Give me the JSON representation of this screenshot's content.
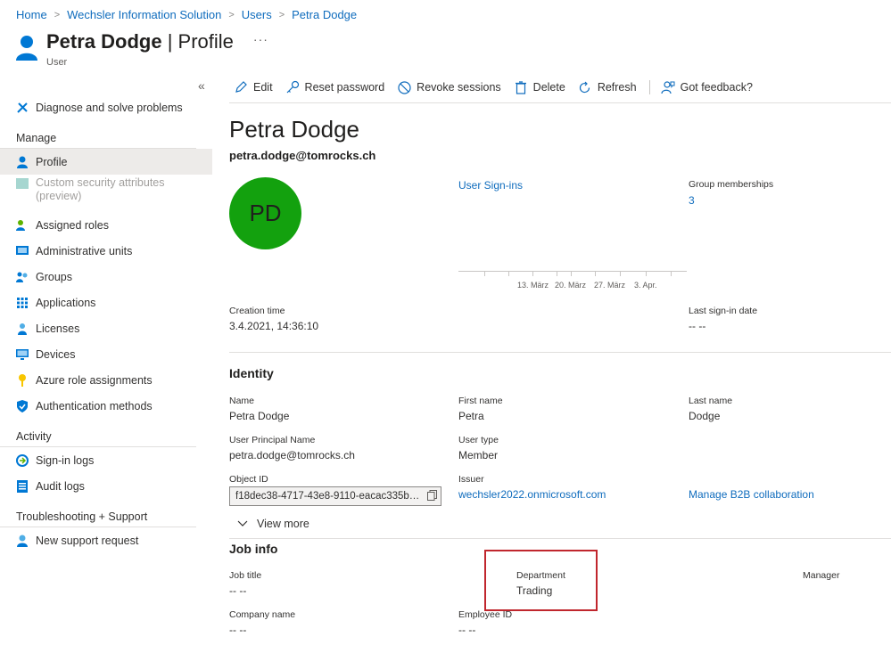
{
  "breadcrumb": [
    "Home",
    "Wechsler Information Solution",
    "Users",
    "Petra Dodge"
  ],
  "header": {
    "name": "Petra Dodge",
    "section": "Profile",
    "subtitle": "User",
    "more": "···"
  },
  "sidebar": {
    "collapse": "«",
    "top_item": "Diagnose and solve problems",
    "manage_label": "Manage",
    "manage": [
      "Profile",
      "Custom security attributes (preview)",
      "Assigned roles",
      "Administrative units",
      "Groups",
      "Applications",
      "Licenses",
      "Devices",
      "Azure role assignments",
      "Authentication methods"
    ],
    "activity_label": "Activity",
    "activity": [
      "Sign-in logs",
      "Audit logs"
    ],
    "support_label": "Troubleshooting + Support",
    "support": [
      "New support request"
    ]
  },
  "toolbar": {
    "edit": "Edit",
    "reset": "Reset password",
    "revoke": "Revoke sessions",
    "delete": "Delete",
    "refresh": "Refresh",
    "feedback": "Got feedback?"
  },
  "profile": {
    "display_name": "Petra Dodge",
    "email": "petra.dodge@tomrocks.ch",
    "initials": "PD",
    "avatar_color": "#13a10e",
    "signins_link": "User Sign-ins",
    "chart_ticks": [
      "13. März",
      "20. März",
      "27. März",
      "3. Apr."
    ],
    "group_label": "Group memberships",
    "group_value": "3",
    "creation_label": "Creation time",
    "creation_value": "3.4.2021, 14:36:10",
    "lastsignin_label": "Last sign-in date",
    "lastsignin_value": "-- --"
  },
  "identity": {
    "title": "Identity",
    "name_label": "Name",
    "name_value": "Petra Dodge",
    "first_label": "First name",
    "first_value": "Petra",
    "last_label": "Last name",
    "last_value": "Dodge",
    "upn_label": "User Principal Name",
    "upn_value": "petra.dodge@tomrocks.ch",
    "type_label": "User type",
    "type_value": "Member",
    "objid_label": "Object ID",
    "objid_value": "f18dec38-4717-43e8-9110-eacac335b…",
    "issuer_label": "Issuer",
    "issuer_value": "wechsler2022.onmicrosoft.com",
    "b2b_link": "Manage B2B collaboration",
    "view_more": "View more"
  },
  "job": {
    "title": "Job info",
    "jobtitle_label": "Job title",
    "jobtitle_value": "-- --",
    "dept_label": "Department",
    "dept_value": "Trading",
    "manager_label": "Manager",
    "company_label": "Company name",
    "company_value": "-- --",
    "empid_label": "Employee ID",
    "empid_value": "-- --"
  },
  "colors": {
    "accent": "#0f6cbd",
    "highlight_box": "#c0262d"
  }
}
